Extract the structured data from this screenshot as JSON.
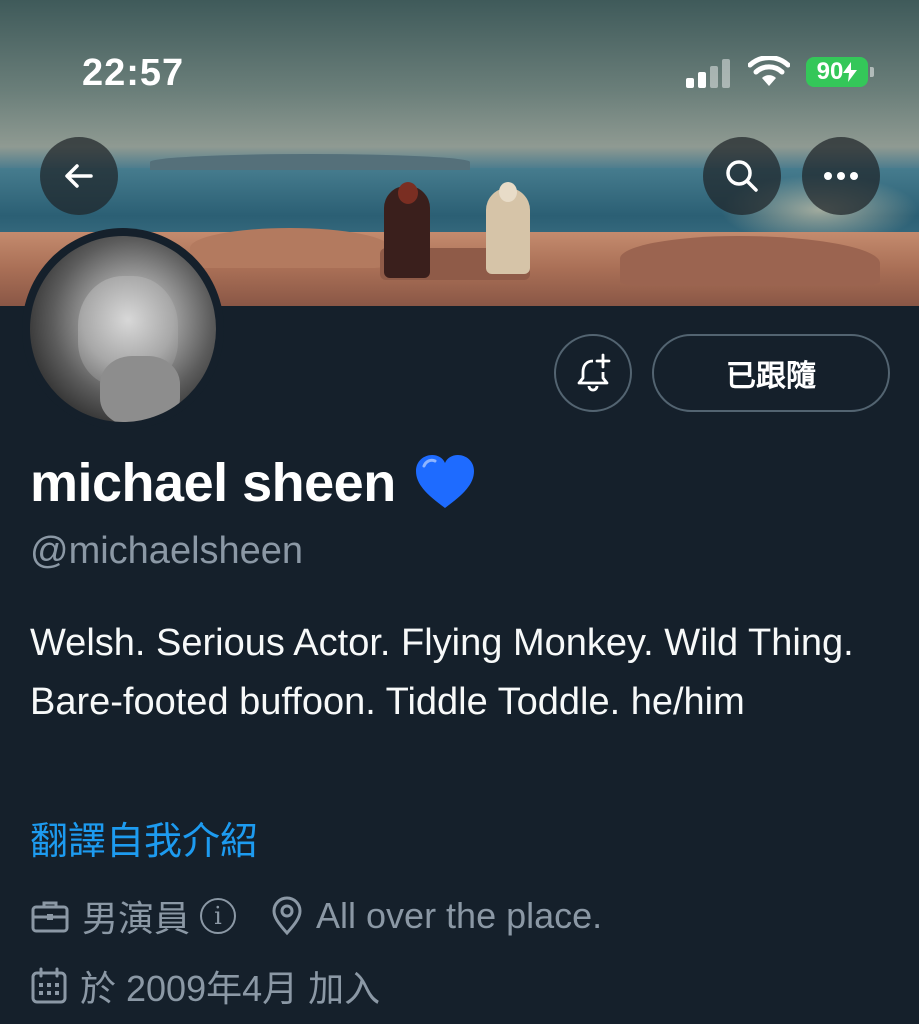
{
  "status_bar": {
    "time": "22:57",
    "battery": "90",
    "battery_color": "#34c759"
  },
  "banner": {
    "back_icon": "arrow-left-icon",
    "search_icon": "search-icon",
    "more_icon": "more-horizontal-icon"
  },
  "actions": {
    "bell_icon": "notification-bell-plus-icon",
    "follow_label": "已跟隨"
  },
  "profile": {
    "name": "michael sheen",
    "name_emoji": "blue-heart-icon",
    "handle": "@michaelsheen",
    "bio": "Welsh. Serious Actor. Flying Monkey. Wild Thing. Bare-footed buffoon. Tiddle Toddle. he/him",
    "translate_label": "翻譯自我介紹",
    "category": "男演員",
    "location": "All over the place.",
    "joined": "於 2009年4月 加入"
  },
  "colors": {
    "background": "#15202b",
    "accent": "#1d9bf0",
    "secondary_text": "#8b98a5",
    "border": "#536471"
  }
}
